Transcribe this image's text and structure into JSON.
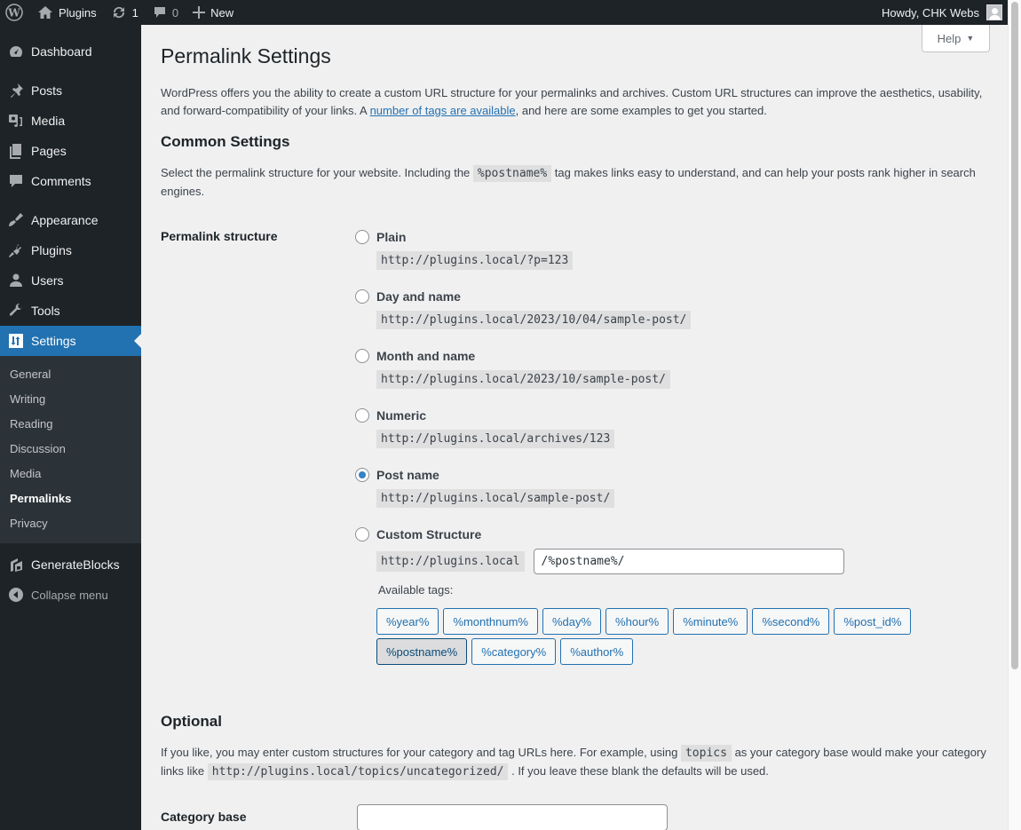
{
  "adminbar": {
    "site_name": "Plugins",
    "updates_count": "1",
    "comments_count": "0",
    "new_label": "New",
    "greeting": "Howdy, CHK Webs"
  },
  "sidebar": {
    "items": [
      {
        "label": "Dashboard",
        "icon": "dashboard-icon"
      },
      {
        "label": "Posts",
        "icon": "pin-icon"
      },
      {
        "label": "Media",
        "icon": "media-icon"
      },
      {
        "label": "Pages",
        "icon": "pages-icon"
      },
      {
        "label": "Comments",
        "icon": "comment-icon"
      },
      {
        "label": "Appearance",
        "icon": "brush-icon"
      },
      {
        "label": "Plugins",
        "icon": "plug-icon"
      },
      {
        "label": "Users",
        "icon": "user-icon"
      },
      {
        "label": "Tools",
        "icon": "wrench-icon"
      },
      {
        "label": "Settings",
        "icon": "settings-icon",
        "active": true
      }
    ],
    "submenu": [
      "General",
      "Writing",
      "Reading",
      "Discussion",
      "Media",
      "Permalinks",
      "Privacy"
    ],
    "submenu_current": "Permalinks",
    "generateblocks": "GenerateBlocks",
    "collapse": "Collapse menu"
  },
  "help_label": "Help",
  "page": {
    "title": "Permalink Settings",
    "intro_before": "WordPress offers you the ability to create a custom URL structure for your permalinks and archives. Custom URL structures can improve the aesthetics, usability, and forward-compatibility of your links. A ",
    "intro_link": "number of tags are available",
    "intro_after": ", and here are some examples to get you started.",
    "common_heading": "Common Settings",
    "common_desc_before": "Select the permalink structure for your website. Including the ",
    "common_desc_code": "%postname%",
    "common_desc_after": " tag makes links easy to understand, and can help your posts rank higher in search engines.",
    "structure_label": "Permalink structure",
    "options": [
      {
        "label": "Plain",
        "example": "http://plugins.local/?p=123",
        "checked": false
      },
      {
        "label": "Day and name",
        "example": "http://plugins.local/2023/10/04/sample-post/",
        "checked": false
      },
      {
        "label": "Month and name",
        "example": "http://plugins.local/2023/10/sample-post/",
        "checked": false
      },
      {
        "label": "Numeric",
        "example": "http://plugins.local/archives/123",
        "checked": false
      },
      {
        "label": "Post name",
        "example": "http://plugins.local/sample-post/",
        "checked": true
      },
      {
        "label": "Custom Structure",
        "checked": false
      }
    ],
    "custom_base": "http://plugins.local",
    "custom_value": "/%postname%/",
    "available_tags_label": "Available tags:",
    "tags": [
      "%year%",
      "%monthnum%",
      "%day%",
      "%hour%",
      "%minute%",
      "%second%",
      "%post_id%",
      "%postname%",
      "%category%",
      "%author%"
    ],
    "active_tag": "%postname%",
    "optional_heading": "Optional",
    "optional_desc_1": "If you like, you may enter custom structures for your category and tag URLs here. For example, using ",
    "optional_code_1": "topics",
    "optional_desc_2": " as your category base would make your category links like ",
    "optional_code_2": "http://plugins.local/topics/uncategorized/",
    "optional_desc_3": " . If you leave these blank the defaults will be used.",
    "category_base_label": "Category base",
    "category_base_value": ""
  },
  "colors": {
    "accent": "#2271b1",
    "adminbar_bg": "#1d2327",
    "submenu_bg": "#2c3338",
    "content_bg": "#f0f0f1"
  }
}
